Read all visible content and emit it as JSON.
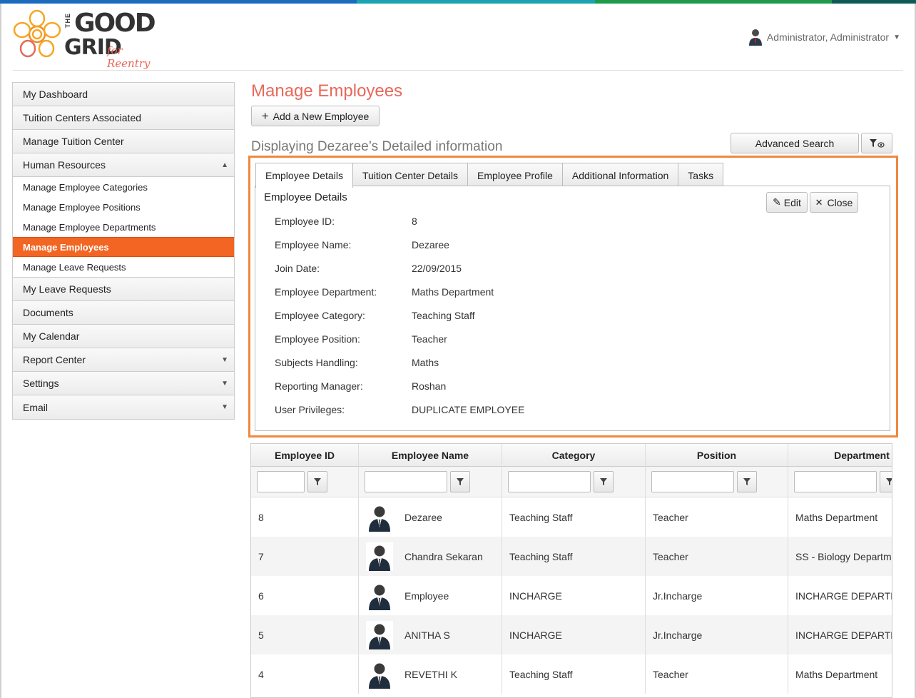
{
  "colors": {
    "accent": "#f26522",
    "title": "#e8685a",
    "highlight_border": "#f0883e"
  },
  "logo": {
    "the": "THE",
    "line1": "GOOD",
    "line2": "GRID",
    "sub": "for Reentry"
  },
  "user": {
    "name": "Administrator, Administrator",
    "icon": "user-avatar-icon"
  },
  "sidebar": {
    "items": [
      {
        "label": "My Dashboard"
      },
      {
        "label": "Tuition Centers Associated"
      },
      {
        "label": "Manage Tuition Center"
      },
      {
        "label": "Human Resources",
        "expanded": true
      }
    ],
    "sub_items": [
      {
        "label": "Manage Employee Categories"
      },
      {
        "label": "Manage Employee Positions"
      },
      {
        "label": "Manage Employee Departments"
      },
      {
        "label": "Manage Employees",
        "active": true
      },
      {
        "label": "Manage Leave Requests"
      }
    ],
    "items_after": [
      {
        "label": "My Leave Requests"
      },
      {
        "label": "Documents"
      },
      {
        "label": "My Calendar"
      },
      {
        "label": "Report Center",
        "has_arrow": true
      },
      {
        "label": "Settings",
        "has_arrow": true
      },
      {
        "label": "Email",
        "has_arrow": true
      }
    ]
  },
  "main": {
    "title": "Manage Employees",
    "add_button": "Add a New Employee",
    "displaying": "Displaying Dezaree’s Detailed information",
    "advanced_search": "Advanced Search"
  },
  "details": {
    "tabs": [
      "Employee Details",
      "Tuition Center Details",
      "Employee Profile",
      "Additional Information",
      "Tasks"
    ],
    "active_tab": 0,
    "heading": "Employee Details",
    "edit": "Edit",
    "close": "Close",
    "fields": [
      {
        "label": "Employee ID:",
        "value": "8"
      },
      {
        "label": "Employee Name:",
        "value": "Dezaree"
      },
      {
        "label": "Join Date:",
        "value": "22/09/2015"
      },
      {
        "label": "Employee Department:",
        "value": "Maths Department"
      },
      {
        "label": "Employee Category:",
        "value": "Teaching Staff"
      },
      {
        "label": "Employee Position:",
        "value": "Teacher"
      },
      {
        "label": "Subjects Handling:",
        "value": "Maths"
      },
      {
        "label": "Reporting Manager:",
        "value": "Roshan"
      },
      {
        "label": "User Privileges:",
        "value": "DUPLICATE EMPLOYEE"
      }
    ]
  },
  "grid": {
    "columns": [
      "Employee ID",
      "Employee Name",
      "Category",
      "Position",
      "Department"
    ],
    "rows": [
      {
        "id": "8",
        "name": "Dezaree",
        "category": "Teaching Staff",
        "position": "Teacher",
        "department": "Maths Department"
      },
      {
        "id": "7",
        "name": "Chandra Sekaran",
        "category": "Teaching Staff",
        "position": "Teacher",
        "department": "SS - Biology Department"
      },
      {
        "id": "6",
        "name": "Employee",
        "category": "INCHARGE",
        "position": "Jr.Incharge",
        "department": "INCHARGE DEPARTMENT"
      },
      {
        "id": "5",
        "name": "ANITHA S",
        "category": "INCHARGE",
        "position": "Jr.Incharge",
        "department": "INCHARGE DEPARTMENT"
      },
      {
        "id": "4",
        "name": "REVETHI K",
        "category": "Teaching Staff",
        "position": "Teacher",
        "department": "Maths Department"
      }
    ]
  }
}
